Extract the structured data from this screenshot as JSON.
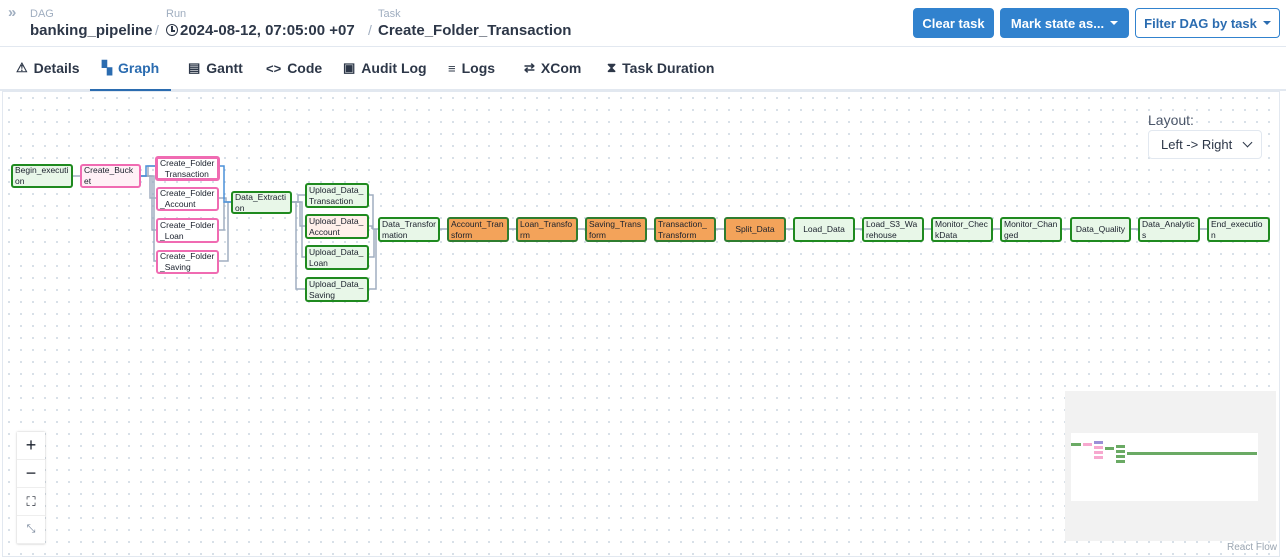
{
  "breadcrumb": {
    "dag_label": "DAG",
    "dag_value": "banking_pipeline",
    "run_label": "Run",
    "run_value": "2024-08-12, 07:05:00 +07",
    "task_label": "Task",
    "task_value": "Create_Folder_Transaction",
    "separator": "/"
  },
  "actions": {
    "clear": "Clear task",
    "mark": "Mark state as...",
    "filter": "Filter DAG by task"
  },
  "tabs": [
    {
      "label": "Details",
      "icon": "warning-icon"
    },
    {
      "label": "Graph",
      "icon": "graph-icon"
    },
    {
      "label": "Gantt",
      "icon": "gantt-icon"
    },
    {
      "label": "Code",
      "icon": "code-icon"
    },
    {
      "label": "Audit Log",
      "icon": "audit-icon"
    },
    {
      "label": "Logs",
      "icon": "logs-icon"
    },
    {
      "label": "XCom",
      "icon": "xcom-icon"
    },
    {
      "label": "Task Duration",
      "icon": "hourglass-icon"
    }
  ],
  "active_tab": "Graph",
  "layout": {
    "label": "Layout:",
    "value": "Left -> Right"
  },
  "nodes": {
    "begin": "Begin_execution",
    "bucket": "Create_Bucket",
    "cf_txn": "Create_Folder_Transaction",
    "cf_acc": "Create_Folder_Account",
    "cf_loan": "Create_Folder_Loan",
    "cf_sav": "Create_Folder_Saving",
    "extract": "Data_Extraction",
    "up_txn": "Upload_Data_Transaction",
    "up_acc": "Upload_Data_Account",
    "up_loan": "Upload_Data_Loan",
    "up_sav": "Upload_Data_Saving",
    "transform": "Data_Transformation",
    "acc_t": "Account_Transform",
    "loan_t": "Loan_Transform",
    "sav_t": "Saving_Transform",
    "txn_t": "Transaction_Transform",
    "split": "Split_Data",
    "load": "Load_Data",
    "load_s3": "Load_S3_Warehouse",
    "mon_check": "Monitor_CheckData",
    "mon_change": "Monitor_Changed",
    "quality": "Data_Quality",
    "analytics": "Data_Analytics",
    "end": "End_execution"
  },
  "attribution": "React Flow",
  "colors": {
    "accent": "#3182ce",
    "success": "#1f8a1f",
    "queued_pink": "#f06bb2",
    "running_orange": "#f3a35a"
  }
}
